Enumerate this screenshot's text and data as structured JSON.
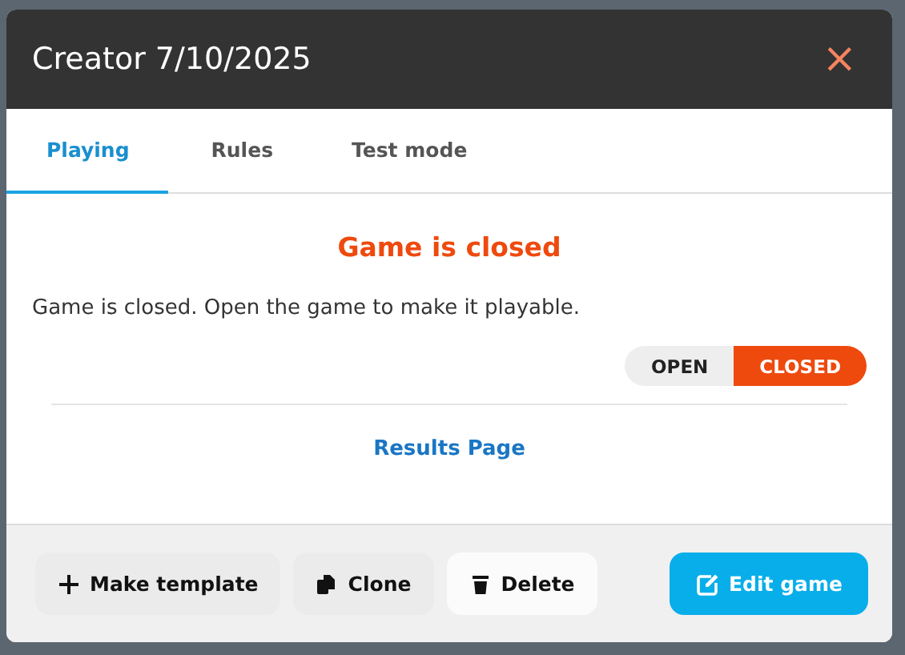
{
  "window": {
    "title": "Creator 7/10/2025",
    "close": "×"
  },
  "tabs": [
    {
      "label": "Playing",
      "selected": true
    },
    {
      "label": "Rules",
      "selected": false
    },
    {
      "label": "Test mode",
      "selected": false
    }
  ],
  "status": {
    "heading": "Game is closed",
    "message": "Game is closed. Open the game to make it playable.",
    "toggle": [
      {
        "label": "OPEN",
        "selected": false
      },
      {
        "label": "CLOSED",
        "selected": true
      }
    ]
  },
  "link": "Results Page",
  "buttons": [
    {
      "label": "Make template",
      "kind": "plain"
    },
    {
      "label": "Clone",
      "kind": "plain"
    },
    {
      "label": "Delete",
      "kind": "light"
    },
    {
      "label": "Edit game",
      "kind": "primary"
    }
  ]
}
